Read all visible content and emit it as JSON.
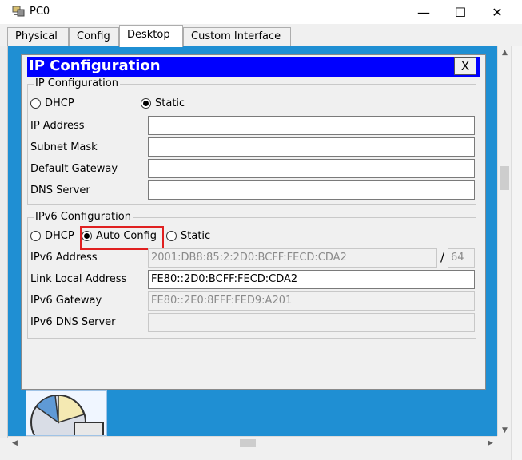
{
  "window": {
    "title": "PC0",
    "minimize_glyph": "—",
    "maximize_glyph": "☐",
    "close_glyph": "✕"
  },
  "tabs": [
    {
      "label": "Physical",
      "active": false
    },
    {
      "label": "Config",
      "active": false
    },
    {
      "label": "Desktop",
      "active": true
    },
    {
      "label": "Custom Interface",
      "active": false
    }
  ],
  "dialog": {
    "title": "IP Configuration",
    "close_label": "X",
    "ipv4": {
      "legend": "IP Configuration",
      "dhcp_label": "DHCP",
      "static_label": "Static",
      "selected": "Static",
      "ip_address_label": "IP Address",
      "ip_address_value": "",
      "subnet_mask_label": "Subnet Mask",
      "subnet_mask_value": "",
      "default_gateway_label": "Default Gateway",
      "default_gateway_value": "",
      "dns_server_label": "DNS Server",
      "dns_server_value": ""
    },
    "ipv6": {
      "legend": "IPv6 Configuration",
      "dhcp_label": "DHCP",
      "auto_config_label": "Auto Config",
      "static_label": "Static",
      "selected": "Auto Config",
      "ipv6_address_label": "IPv6 Address",
      "ipv6_address_value": "2001:DB8:85:2:2D0:BCFF:FECD:CDA2",
      "prefix_separator": "/",
      "prefix_value": "64",
      "link_local_label": "Link Local Address",
      "link_local_value": "FE80::2D0:BCFF:FECD:CDA2",
      "gateway_label": "IPv6 Gateway",
      "gateway_value": "FE80::2E0:8FFF:FED9:A201",
      "dns_label": "IPv6 DNS Server",
      "dns_value": ""
    }
  },
  "colors": {
    "title_bar": "#0000ff",
    "desktop": "#1f8fd3",
    "highlight": "#e02020"
  },
  "icons": [
    "pc-app-icon",
    "minimize-icon",
    "maximize-icon",
    "close-icon",
    "pie-chart-icon"
  ]
}
